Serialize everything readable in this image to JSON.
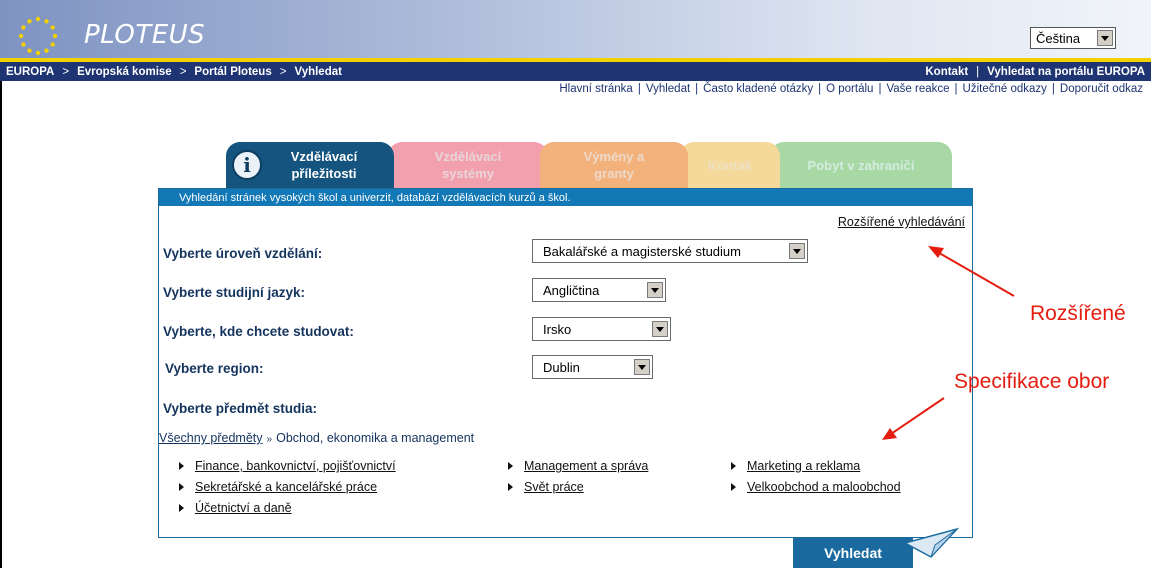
{
  "header": {
    "logo_text": "PLOTEUS",
    "language": "Čeština"
  },
  "breadcrumb": {
    "items": [
      "EUROPA",
      "Evropská komise",
      "Portál Ploteus",
      "Vyhledat"
    ],
    "separator": ">",
    "right_links": [
      "Kontakt",
      "Vyhledat na portálu EUROPA"
    ]
  },
  "top_nav": [
    "Hlavní stránka",
    "Vyhledat",
    "Často kladené otázky",
    "O portálu",
    "Vaše reakce",
    "Užitečné odkazy",
    "Doporučit odkaz"
  ],
  "tabs": [
    {
      "line1": "Vzdělávací",
      "line2": "příležitosti"
    },
    {
      "line1": "Vzdělávací",
      "line2": "systémy"
    },
    {
      "line1": "Výmény a",
      "line2": "granty"
    },
    {
      "line1": "Kontak",
      "line2": ""
    },
    {
      "line1": "Pobyt v zahraničí",
      "line2": ""
    }
  ],
  "panel": {
    "description": "Vyhledání stránek vysokých škol a univerzit, databází vzdělávacích kurzů a škol.",
    "advanced_link": "Rozšířené vyhledávání",
    "fields": [
      {
        "label": "Vyberte úroveň vzdělání:",
        "value": "Bakalářské a magisterské studium"
      },
      {
        "label": "Vyberte studijní jazyk:",
        "value": "Angličtina"
      },
      {
        "label": "Vyberte, kde chcete studovat:",
        "value": "Irsko"
      },
      {
        "label": "Vyberte region:",
        "value": "Dublin"
      }
    ],
    "subject_label": "Vyberte předmět studia:",
    "subject_crumb": {
      "root": "Všechny předměty",
      "separator": "»",
      "current": "Obchod, ekonomika a management"
    },
    "subjects": [
      "Finance, bankovnictví, pojišťovnictví",
      "Management a správa",
      "Marketing a reklama",
      "Sekretářské a kancelářské práce",
      "Svět práce",
      "Velkoobchod a maloobchod",
      "Účetnictví a daně"
    ],
    "search_button": "Vyhledat"
  },
  "annotations": {
    "advanced": "Rozšířené",
    "specification": "Specifikace obor"
  },
  "colors": {
    "header_bar": "#1e3473",
    "accent_yellow": "#f3d000",
    "panel_blue": "#1378b6",
    "annotation_red": "#e51c10"
  }
}
